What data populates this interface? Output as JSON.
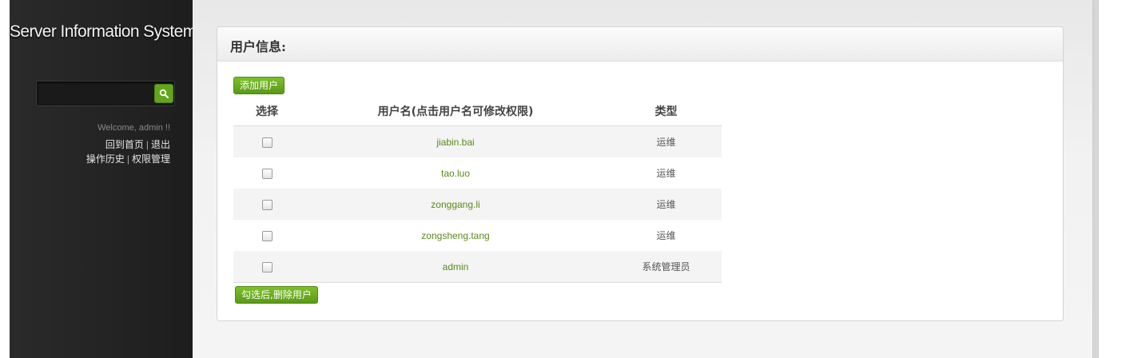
{
  "sidebar": {
    "app_title": "Server Information System",
    "search": {
      "placeholder": ""
    },
    "welcome": "Welcome, admin !!",
    "links": {
      "home": "回到首页",
      "logout": "退出",
      "history": "操作历史",
      "permissions": "权限管理",
      "separator": "|"
    }
  },
  "panel": {
    "title": "用户信息:",
    "add_button": "添加用户",
    "delete_button": "勾选后,删除用户",
    "columns": {
      "select": "选择",
      "username": "用户名(点击用户名可修改权限)",
      "type": "类型"
    },
    "rows": [
      {
        "username": "jiabin.bai",
        "type": "运维",
        "checked": false
      },
      {
        "username": "tao.luo",
        "type": "运维",
        "checked": false
      },
      {
        "username": "zonggang.li",
        "type": "运维",
        "checked": false
      },
      {
        "username": "zongsheng.tang",
        "type": "运维",
        "checked": false
      },
      {
        "username": "admin",
        "type": "系统管理员",
        "checked": false
      }
    ]
  },
  "colors": {
    "accent_green": "#63a51c",
    "link_green": "#5a8a1a",
    "sidebar_bg": "#232323"
  },
  "icons": {
    "search": "search-icon"
  }
}
